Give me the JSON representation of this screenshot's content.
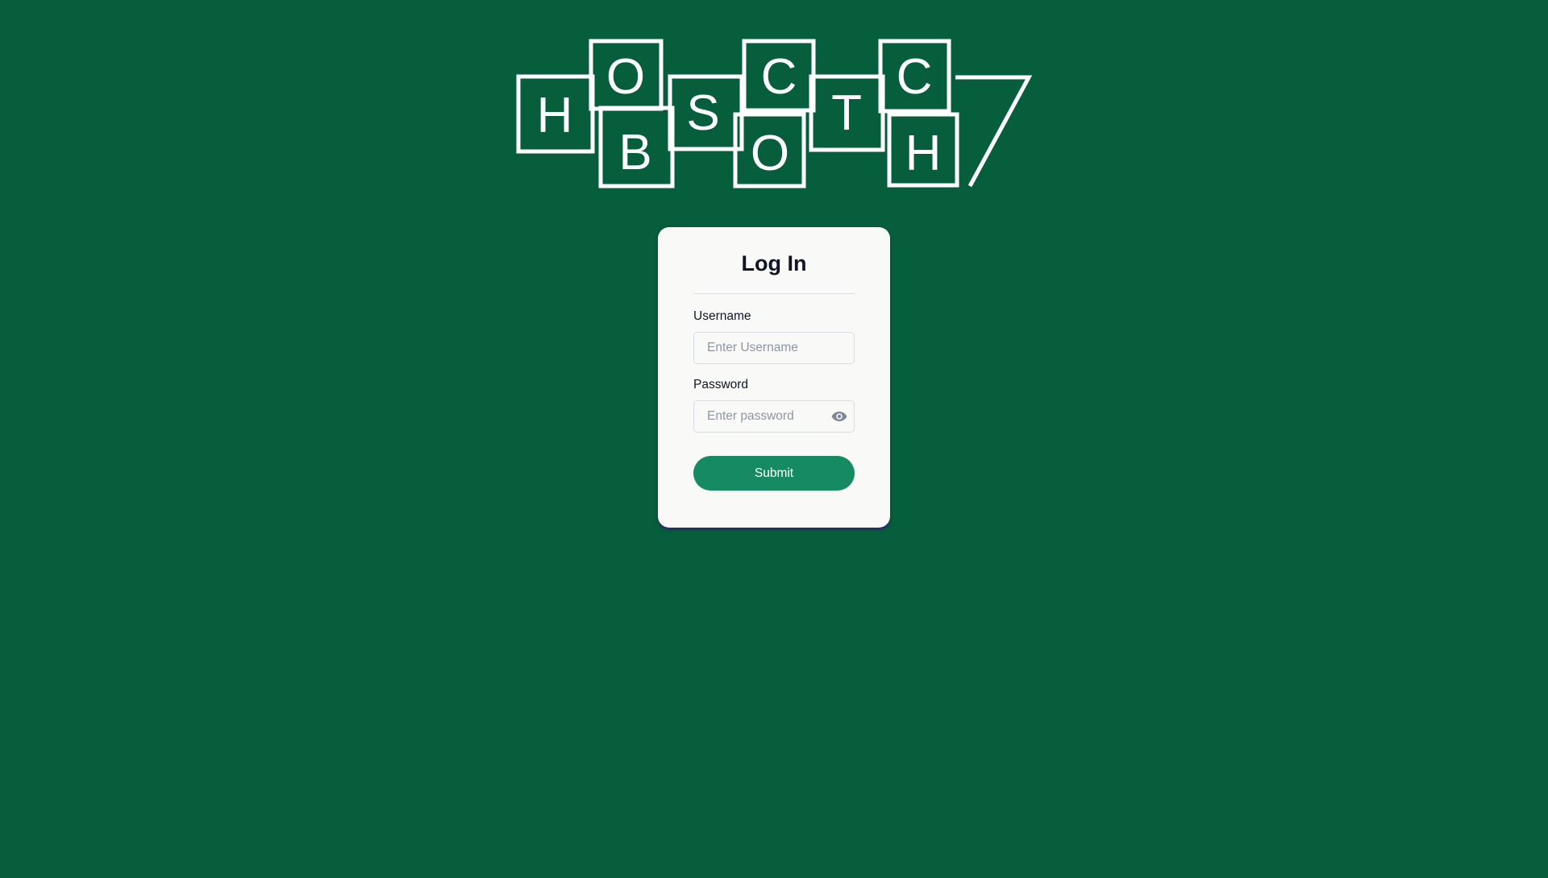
{
  "logo": {
    "name": "hopscotch-logo",
    "letters": [
      "H",
      "O",
      "B",
      "S",
      "C",
      "O",
      "T",
      "C",
      "H"
    ]
  },
  "login": {
    "title": "Log In",
    "username_label": "Username",
    "username_placeholder": "Enter Username",
    "username_value": "",
    "password_label": "Password",
    "password_placeholder": "Enter password",
    "password_value": "",
    "password_toggle_icon": "eye-icon",
    "submit_label": "Submit"
  },
  "colors": {
    "background": "#075e3d",
    "card": "#f9f9f7",
    "submit": "#168a63",
    "logo_stroke": "#ffffff"
  }
}
